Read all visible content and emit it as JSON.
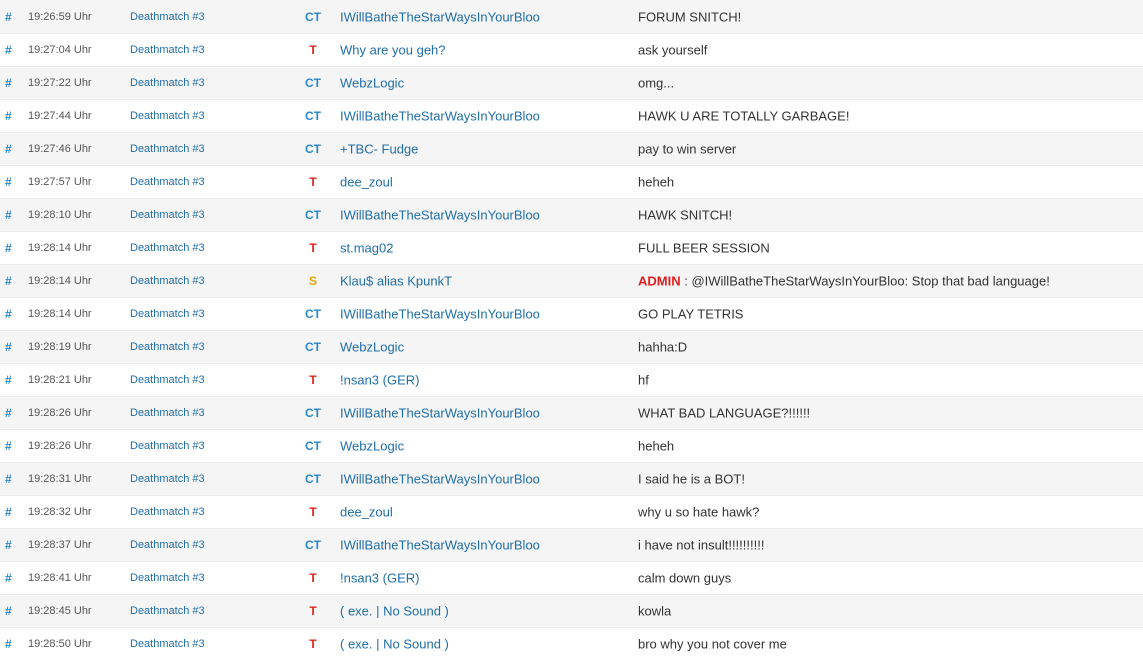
{
  "chat": {
    "hash_symbol": "#",
    "rows": [
      {
        "time": "19:26:59 Uhr",
        "server": "Deathmatch #3",
        "team": "CT",
        "player": "IWillBatheTheStarWaysInYourBloo",
        "admin_tag": "",
        "message": "FORUM SNITCH!"
      },
      {
        "time": "19:27:04 Uhr",
        "server": "Deathmatch #3",
        "team": "T",
        "player": "Why are you geh?",
        "admin_tag": "",
        "message": "ask yourself"
      },
      {
        "time": "19:27:22 Uhr",
        "server": "Deathmatch #3",
        "team": "CT",
        "player": "WebzLogic",
        "admin_tag": "",
        "message": "omg..."
      },
      {
        "time": "19:27:44 Uhr",
        "server": "Deathmatch #3",
        "team": "CT",
        "player": "IWillBatheTheStarWaysInYourBloo",
        "admin_tag": "",
        "message": "HAWK U ARE TOTALLY GARBAGE!"
      },
      {
        "time": "19:27:46 Uhr",
        "server": "Deathmatch #3",
        "team": "CT",
        "player": "+TBC- Fudge",
        "admin_tag": "",
        "message": "pay to win server"
      },
      {
        "time": "19:27:57 Uhr",
        "server": "Deathmatch #3",
        "team": "T",
        "player": "dee_zoul",
        "admin_tag": "",
        "message": "heheh"
      },
      {
        "time": "19:28:10 Uhr",
        "server": "Deathmatch #3",
        "team": "CT",
        "player": "IWillBatheTheStarWaysInYourBloo",
        "admin_tag": "",
        "message": "HAWK SNITCH!"
      },
      {
        "time": "19:28:14 Uhr",
        "server": "Deathmatch #3",
        "team": "T",
        "player": "st.mag02",
        "admin_tag": "",
        "message": "FULL BEER SESSION"
      },
      {
        "time": "19:28:14 Uhr",
        "server": "Deathmatch #3",
        "team": "S",
        "player": "Klau$ alias KpunkT",
        "admin_tag": "ADMIN",
        "message": " : @IWillBatheTheStarWaysInYourBloo: Stop that bad language!"
      },
      {
        "time": "19:28:14 Uhr",
        "server": "Deathmatch #3",
        "team": "CT",
        "player": "IWillBatheTheStarWaysInYourBloo",
        "admin_tag": "",
        "message": "GO PLAY TETRIS"
      },
      {
        "time": "19:28:19 Uhr",
        "server": "Deathmatch #3",
        "team": "CT",
        "player": "WebzLogic",
        "admin_tag": "",
        "message": "hahha:D"
      },
      {
        "time": "19:28:21 Uhr",
        "server": "Deathmatch #3",
        "team": "T",
        "player": "!nsan3 (GER)",
        "admin_tag": "",
        "message": "hf"
      },
      {
        "time": "19:28:26 Uhr",
        "server": "Deathmatch #3",
        "team": "CT",
        "player": "IWillBatheTheStarWaysInYourBloo",
        "admin_tag": "",
        "message": "WHAT BAD LANGUAGE?!!!!!!"
      },
      {
        "time": "19:28:26 Uhr",
        "server": "Deathmatch #3",
        "team": "CT",
        "player": "WebzLogic",
        "admin_tag": "",
        "message": "heheh"
      },
      {
        "time": "19:28:31 Uhr",
        "server": "Deathmatch #3",
        "team": "CT",
        "player": "IWillBatheTheStarWaysInYourBloo",
        "admin_tag": "",
        "message": "I said he is a BOT!"
      },
      {
        "time": "19:28:32 Uhr",
        "server": "Deathmatch #3",
        "team": "T",
        "player": "dee_zoul",
        "admin_tag": "",
        "message": "why u so hate hawk?"
      },
      {
        "time": "19:28:37 Uhr",
        "server": "Deathmatch #3",
        "team": "CT",
        "player": "IWillBatheTheStarWaysInYourBloo",
        "admin_tag": "",
        "message": "i have not insult!!!!!!!!!!"
      },
      {
        "time": "19:28:41 Uhr",
        "server": "Deathmatch #3",
        "team": "T",
        "player": "!nsan3 (GER)",
        "admin_tag": "",
        "message": "calm down guys"
      },
      {
        "time": "19:28:45 Uhr",
        "server": "Deathmatch #3",
        "team": "T",
        "player": "( exe. | No Sound )",
        "admin_tag": "",
        "message": "kowla"
      },
      {
        "time": "19:28:50 Uhr",
        "server": "Deathmatch #3",
        "team": "T",
        "player": "( exe. | No Sound )",
        "admin_tag": "",
        "message": "bro why you not cover me"
      }
    ]
  },
  "colors": {
    "ct": "#2a87c9",
    "t": "#d9261c",
    "s": "#e8a600",
    "admin": "#e02020",
    "link": "#1f6ea8"
  }
}
